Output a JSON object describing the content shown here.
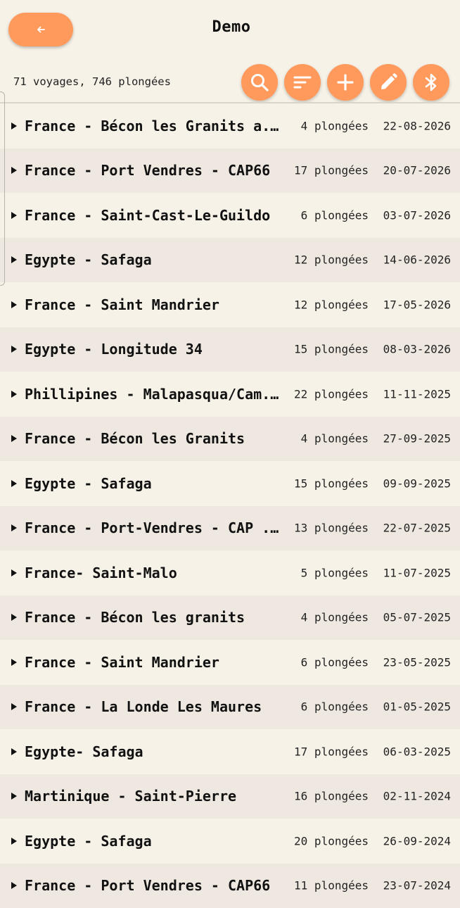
{
  "header": {
    "title": "Demo",
    "back_icon": "arrow-left-icon"
  },
  "toolbar": {
    "summary": "71 voyages, 746 plongées",
    "buttons": [
      "search-icon",
      "sort-icon",
      "plus-icon",
      "pencil-icon",
      "bluetooth-icon"
    ]
  },
  "colors": {
    "accent": "#ff9a5c",
    "background": "#f7f2e8",
    "row_alt": "#eee8e0"
  },
  "trips": [
    {
      "name": "France - Bécon les Granits a...",
      "count": "4 plongées",
      "date": "22-08-2026"
    },
    {
      "name": "France - Port Vendres - CAP66",
      "count": "17 plongées",
      "date": "20-07-2026"
    },
    {
      "name": "France - Saint-Cast-Le-Guildo",
      "count": "6 plongées",
      "date": "03-07-2026"
    },
    {
      "name": "Egypte - Safaga",
      "count": "12 plongées",
      "date": "14-06-2026"
    },
    {
      "name": "France - Saint Mandrier",
      "count": "12 plongées",
      "date": "17-05-2026"
    },
    {
      "name": "Egypte - Longitude 34",
      "count": "15 plongées",
      "date": "08-03-2026"
    },
    {
      "name": "Phillipines - Malapasqua/Cam...",
      "count": "22 plongées",
      "date": "11-11-2025"
    },
    {
      "name": "France - Bécon les Granits",
      "count": "4 plongées",
      "date": "27-09-2025"
    },
    {
      "name": "Egypte - Safaga",
      "count": "15 plongées",
      "date": "09-09-2025"
    },
    {
      "name": "France - Port-Vendres - CAP ...",
      "count": "13 plongées",
      "date": "22-07-2025"
    },
    {
      "name": "France- Saint-Malo",
      "count": "5 plongées",
      "date": "11-07-2025"
    },
    {
      "name": "France - Bécon les granits",
      "count": "4 plongées",
      "date": "05-07-2025"
    },
    {
      "name": "France - Saint Mandrier",
      "count": "6 plongées",
      "date": "23-05-2025"
    },
    {
      "name": "France - La Londe Les Maures",
      "count": "6 plongées",
      "date": "01-05-2025"
    },
    {
      "name": "Egypte- Safaga",
      "count": "17 plongées",
      "date": "06-03-2025"
    },
    {
      "name": "Martinique - Saint-Pierre",
      "count": "16 plongées",
      "date": "02-11-2024"
    },
    {
      "name": "Egypte - Safaga",
      "count": "20 plongées",
      "date": "26-09-2024"
    },
    {
      "name": "France - Port Vendres - CAP66",
      "count": "11 plongées",
      "date": "23-07-2024"
    }
  ]
}
